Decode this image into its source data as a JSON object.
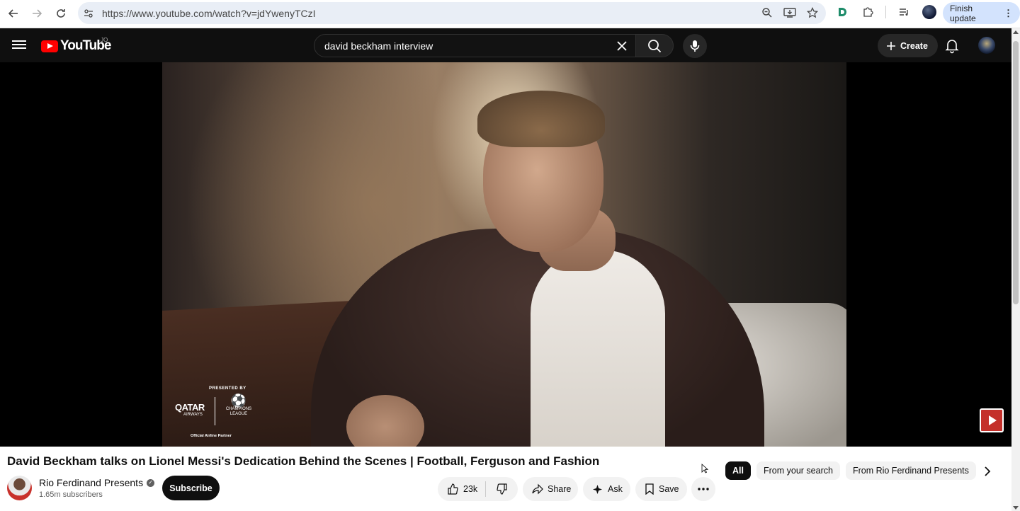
{
  "browser": {
    "url": "https://www.youtube.com/watch?v=jdYwenyTCzI",
    "finish_update_label": "Finish update",
    "icons": [
      "back-icon",
      "forward-icon",
      "reload-icon",
      "site-info-icon",
      "zoom-icon",
      "install-app-icon",
      "bookmark-star-icon",
      "extension-d-icon",
      "extensions-puzzle-icon",
      "media-controls-icon",
      "profile-icon",
      "menu-kebab-icon"
    ]
  },
  "youtube": {
    "logo_text": "YouTube",
    "country_code": "JO",
    "search_query": "david beckham interview",
    "create_label": "Create",
    "brand_red": "#ff0000"
  },
  "video": {
    "sponsor_presented": "PRESENTED BY",
    "sponsor_qatar": "QATAR",
    "sponsor_airways": "AIRWAYS",
    "sponsor_ucl": "CHAMPIONS LEAGUE",
    "sponsor_partner": "Official Airline Partner"
  },
  "details": {
    "title": "David Beckham talks on Lionel Messi's Dedication Behind the Scenes | Football, Ferguson and Fashion",
    "channel_name": "Rio Ferdinand Presents",
    "subscribers": "1.65m subscribers",
    "subscribe_label": "Subscribe",
    "likes": "23k",
    "share_label": "Share",
    "ask_label": "Ask",
    "save_label": "Save"
  },
  "chips": {
    "items": [
      "All",
      "From your search",
      "From Rio Ferdinand Presents"
    ],
    "active": "All"
  }
}
